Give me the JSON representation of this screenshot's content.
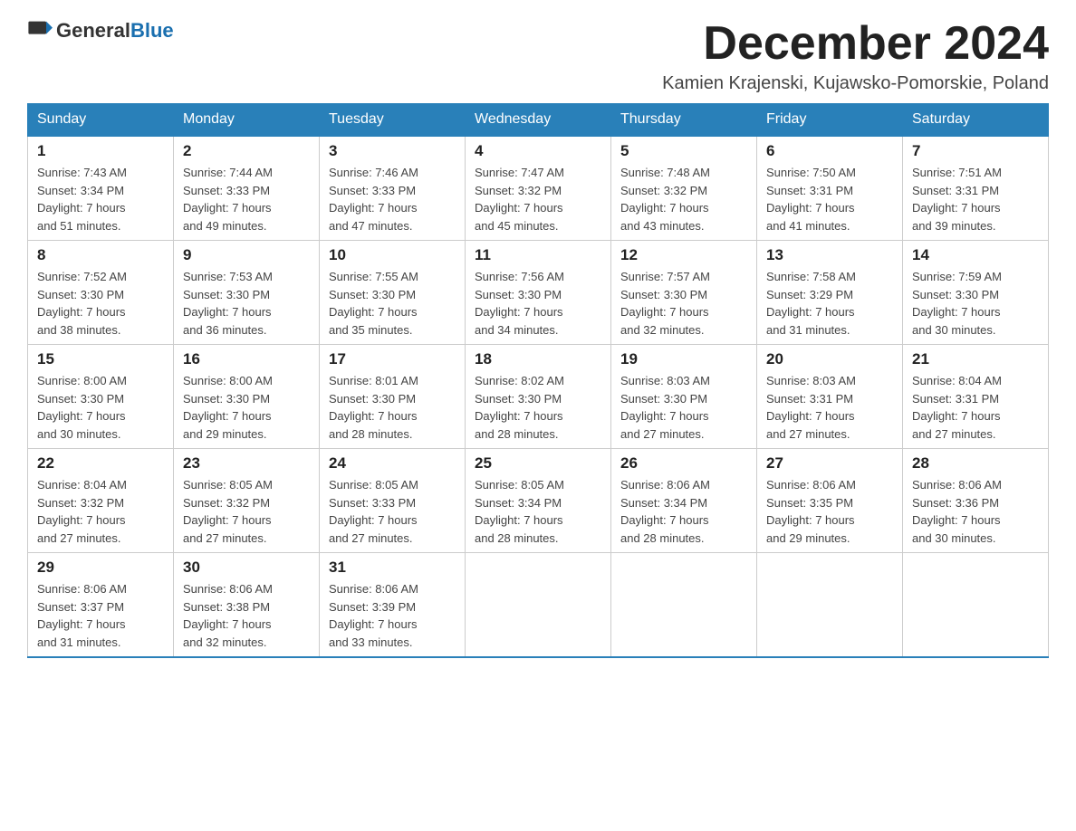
{
  "header": {
    "logo": {
      "general": "General",
      "blue": "Blue"
    },
    "title": "December 2024",
    "location": "Kamien Krajenski, Kujawsko-Pomorskie, Poland"
  },
  "days_of_week": [
    "Sunday",
    "Monday",
    "Tuesday",
    "Wednesday",
    "Thursday",
    "Friday",
    "Saturday"
  ],
  "weeks": [
    [
      {
        "day": "1",
        "sunrise": "7:43 AM",
        "sunset": "3:34 PM",
        "daylight": "7 hours and 51 minutes."
      },
      {
        "day": "2",
        "sunrise": "7:44 AM",
        "sunset": "3:33 PM",
        "daylight": "7 hours and 49 minutes."
      },
      {
        "day": "3",
        "sunrise": "7:46 AM",
        "sunset": "3:33 PM",
        "daylight": "7 hours and 47 minutes."
      },
      {
        "day": "4",
        "sunrise": "7:47 AM",
        "sunset": "3:32 PM",
        "daylight": "7 hours and 45 minutes."
      },
      {
        "day": "5",
        "sunrise": "7:48 AM",
        "sunset": "3:32 PM",
        "daylight": "7 hours and 43 minutes."
      },
      {
        "day": "6",
        "sunrise": "7:50 AM",
        "sunset": "3:31 PM",
        "daylight": "7 hours and 41 minutes."
      },
      {
        "day": "7",
        "sunrise": "7:51 AM",
        "sunset": "3:31 PM",
        "daylight": "7 hours and 39 minutes."
      }
    ],
    [
      {
        "day": "8",
        "sunrise": "7:52 AM",
        "sunset": "3:30 PM",
        "daylight": "7 hours and 38 minutes."
      },
      {
        "day": "9",
        "sunrise": "7:53 AM",
        "sunset": "3:30 PM",
        "daylight": "7 hours and 36 minutes."
      },
      {
        "day": "10",
        "sunrise": "7:55 AM",
        "sunset": "3:30 PM",
        "daylight": "7 hours and 35 minutes."
      },
      {
        "day": "11",
        "sunrise": "7:56 AM",
        "sunset": "3:30 PM",
        "daylight": "7 hours and 34 minutes."
      },
      {
        "day": "12",
        "sunrise": "7:57 AM",
        "sunset": "3:30 PM",
        "daylight": "7 hours and 32 minutes."
      },
      {
        "day": "13",
        "sunrise": "7:58 AM",
        "sunset": "3:29 PM",
        "daylight": "7 hours and 31 minutes."
      },
      {
        "day": "14",
        "sunrise": "7:59 AM",
        "sunset": "3:30 PM",
        "daylight": "7 hours and 30 minutes."
      }
    ],
    [
      {
        "day": "15",
        "sunrise": "8:00 AM",
        "sunset": "3:30 PM",
        "daylight": "7 hours and 30 minutes."
      },
      {
        "day": "16",
        "sunrise": "8:00 AM",
        "sunset": "3:30 PM",
        "daylight": "7 hours and 29 minutes."
      },
      {
        "day": "17",
        "sunrise": "8:01 AM",
        "sunset": "3:30 PM",
        "daylight": "7 hours and 28 minutes."
      },
      {
        "day": "18",
        "sunrise": "8:02 AM",
        "sunset": "3:30 PM",
        "daylight": "7 hours and 28 minutes."
      },
      {
        "day": "19",
        "sunrise": "8:03 AM",
        "sunset": "3:30 PM",
        "daylight": "7 hours and 27 minutes."
      },
      {
        "day": "20",
        "sunrise": "8:03 AM",
        "sunset": "3:31 PM",
        "daylight": "7 hours and 27 minutes."
      },
      {
        "day": "21",
        "sunrise": "8:04 AM",
        "sunset": "3:31 PM",
        "daylight": "7 hours and 27 minutes."
      }
    ],
    [
      {
        "day": "22",
        "sunrise": "8:04 AM",
        "sunset": "3:32 PM",
        "daylight": "7 hours and 27 minutes."
      },
      {
        "day": "23",
        "sunrise": "8:05 AM",
        "sunset": "3:32 PM",
        "daylight": "7 hours and 27 minutes."
      },
      {
        "day": "24",
        "sunrise": "8:05 AM",
        "sunset": "3:33 PM",
        "daylight": "7 hours and 27 minutes."
      },
      {
        "day": "25",
        "sunrise": "8:05 AM",
        "sunset": "3:34 PM",
        "daylight": "7 hours and 28 minutes."
      },
      {
        "day": "26",
        "sunrise": "8:06 AM",
        "sunset": "3:34 PM",
        "daylight": "7 hours and 28 minutes."
      },
      {
        "day": "27",
        "sunrise": "8:06 AM",
        "sunset": "3:35 PM",
        "daylight": "7 hours and 29 minutes."
      },
      {
        "day": "28",
        "sunrise": "8:06 AM",
        "sunset": "3:36 PM",
        "daylight": "7 hours and 30 minutes."
      }
    ],
    [
      {
        "day": "29",
        "sunrise": "8:06 AM",
        "sunset": "3:37 PM",
        "daylight": "7 hours and 31 minutes."
      },
      {
        "day": "30",
        "sunrise": "8:06 AM",
        "sunset": "3:38 PM",
        "daylight": "7 hours and 32 minutes."
      },
      {
        "day": "31",
        "sunrise": "8:06 AM",
        "sunset": "3:39 PM",
        "daylight": "7 hours and 33 minutes."
      },
      null,
      null,
      null,
      null
    ]
  ],
  "labels": {
    "sunrise": "Sunrise:",
    "sunset": "Sunset:",
    "daylight": "Daylight:"
  }
}
